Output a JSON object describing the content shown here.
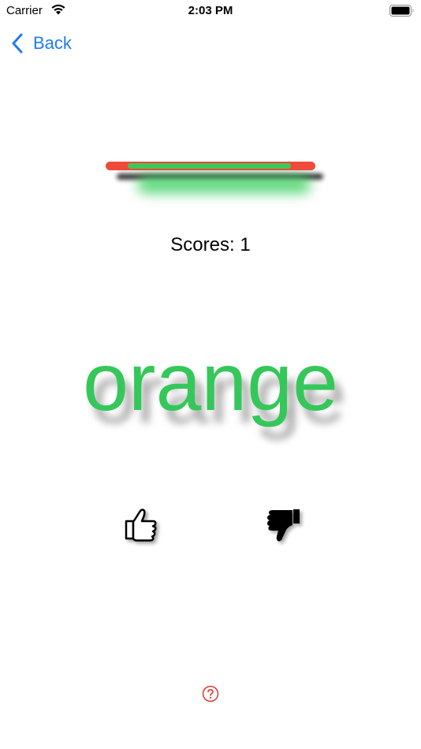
{
  "status_bar": {
    "carrier": "Carrier",
    "time": "2:03 PM"
  },
  "nav": {
    "back_label": "Back",
    "accent_color": "#1e7cf2"
  },
  "timer": {
    "remaining_fraction": 0.78,
    "track_color": "#f04a3c",
    "fill_color": "#3ec85a"
  },
  "score": {
    "text": "Scores: 1"
  },
  "word": {
    "text": "orange",
    "color": "#35c75a"
  },
  "actions": {
    "like_icon": "thumbs-up-icon",
    "dislike_icon": "thumbs-down-icon"
  },
  "help": {
    "icon": "question-circle-icon",
    "color": "#e0382c"
  }
}
